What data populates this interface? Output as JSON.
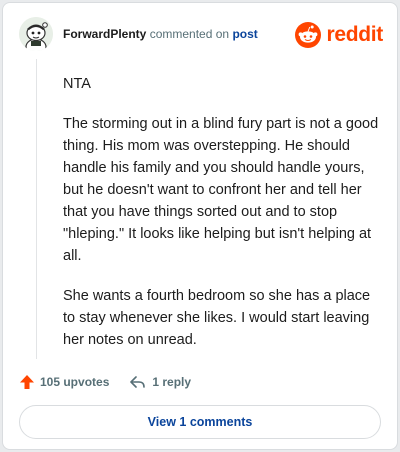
{
  "comment": {
    "author": "ForwardPlenty",
    "action_text": "commented on",
    "post_link": "post",
    "paragraphs": [
      "NTA",
      "The storming out in a blind fury part is not a good thing. His mom was overstepping. He should handle his family and you should handle yours, but he doesn't want to confront her and tell her that you have things sorted out and to stop \"hleping.\" It looks like helping but isn't helping at all.",
      "She wants a fourth bedroom so she has a place to stay whenever she likes. I would start leaving her notes on unread."
    ],
    "upvotes": "105 upvotes",
    "replies": "1 reply",
    "view_comments": "View 1 comments"
  },
  "brand": {
    "name": "reddit",
    "color": "#ff4500"
  },
  "icons": {
    "upvote": "upvote-arrow-icon",
    "reply": "reply-arrow-icon",
    "logo": "reddit-snoo-icon",
    "avatar": "user-avatar-icon"
  }
}
